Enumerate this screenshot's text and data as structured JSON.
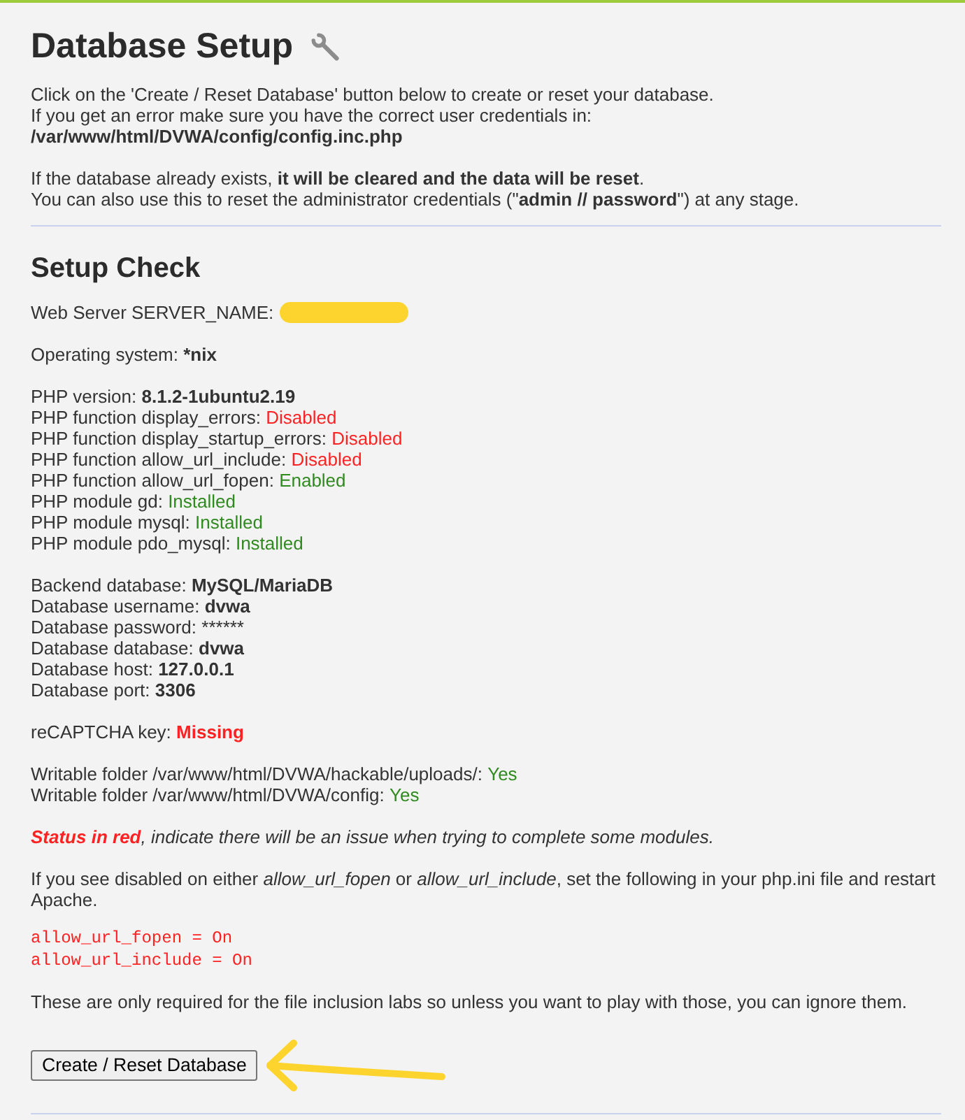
{
  "heading": {
    "title": "Database Setup"
  },
  "intro": [
    {
      "kind": "sentence",
      "text": "Click on the 'Create / Reset Database' button below to create or reset your database."
    },
    {
      "kind": "sentence",
      "text": "If you get an error make sure you have the correct user credentials in:"
    },
    {
      "kind": "path",
      "text": "/var/www/html/DVWA/config/config.inc.php"
    }
  ],
  "warning": [
    "If the database already exists, **it will be cleared and the data will be reset**.",
    "You can also use this to reset the administrator credentials (\"**admin // password**\") at any stage."
  ],
  "setup_check": {
    "title": "Setup Check",
    "groups": [
      {
        "items": [
          {
            "kind": "redacted",
            "label": "Web Server SERVER_NAME:"
          }
        ]
      },
      {
        "items": [
          {
            "kind": "value",
            "label": "Operating system:",
            "value": "*nix",
            "color": "#333333",
            "bold": true
          }
        ]
      },
      {
        "items": [
          {
            "kind": "value",
            "label": "PHP version:",
            "value": "8.1.2-1ubuntu2.19",
            "color": "#333333",
            "bold": true
          },
          {
            "kind": "value",
            "label": "PHP function display_errors:",
            "value": "Disabled",
            "color": "#ff2222",
            "bold": false
          },
          {
            "kind": "value",
            "label": "PHP function display_startup_errors:",
            "value": "Disabled",
            "color": "#ff2222",
            "bold": false
          },
          {
            "kind": "value",
            "label": "PHP function allow_url_include:",
            "value": "Disabled",
            "color": "#ff2222",
            "bold": false
          },
          {
            "kind": "value",
            "label": "PHP function allow_url_fopen:",
            "value": "Enabled",
            "color": "#2f8a1f",
            "bold": false
          },
          {
            "kind": "value",
            "label": "PHP module gd:",
            "value": "Installed",
            "color": "#2f8a1f",
            "bold": false
          },
          {
            "kind": "value",
            "label": "PHP module mysql:",
            "value": "Installed",
            "color": "#2f8a1f",
            "bold": false
          },
          {
            "kind": "value",
            "label": "PHP module pdo_mysql:",
            "value": "Installed",
            "color": "#2f8a1f",
            "bold": false
          }
        ]
      },
      {
        "items": [
          {
            "kind": "value",
            "label": "Backend database:",
            "value": "MySQL/MariaDB",
            "color": "#333333",
            "bold": true
          },
          {
            "kind": "value",
            "label": "Database username:",
            "value": "dvwa",
            "color": "#333333",
            "bold": true
          },
          {
            "kind": "value",
            "label": "Database password:",
            "value": "******",
            "color": "#333333",
            "bold": false
          },
          {
            "kind": "value",
            "label": "Database database:",
            "value": "dvwa",
            "color": "#333333",
            "bold": true
          },
          {
            "kind": "value",
            "label": "Database host:",
            "value": "127.0.0.1",
            "color": "#333333",
            "bold": true
          },
          {
            "kind": "value",
            "label": "Database port:",
            "value": "3306",
            "color": "#333333",
            "bold": true
          }
        ]
      },
      {
        "items": [
          {
            "kind": "value",
            "label": "reCAPTCHA key:",
            "value": "Missing",
            "color": "#ff2222",
            "bold": true
          }
        ]
      },
      {
        "items": [
          {
            "kind": "value",
            "label": "Writable folder /var/www/html/DVWA/hackable/uploads/:",
            "value": "Yes",
            "color": "#2f8a1f",
            "bold": false
          },
          {
            "kind": "value",
            "label": "Writable folder /var/www/html/DVWA/config:",
            "value": "Yes",
            "color": "#2f8a1f",
            "bold": false
          }
        ]
      }
    ]
  },
  "status_note": {
    "emphasis": "Status in red",
    "text": ", indicate there will be an issue when trying to complete some modules."
  },
  "instructions": "If you see disabled on either *allow_url_fopen* or *allow_url_include*, set the following in your php.ini file and restart Apache.",
  "config_lines": [
    "allow_url_fopen = On",
    "allow_url_include = On"
  ],
  "note": "These are only required for the file inclusion labs so unless you want to play with those, you can ignore them.",
  "button": {
    "label": "Create / Reset Database"
  }
}
